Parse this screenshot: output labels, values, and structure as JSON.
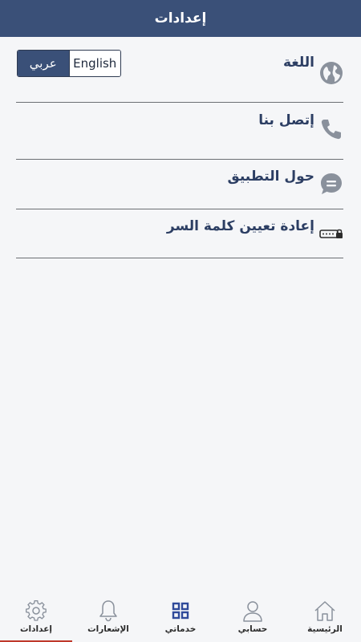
{
  "header": {
    "title": "إعدادات"
  },
  "settings": {
    "language": {
      "label": "اللغة",
      "options": {
        "arabic": "عربي",
        "english": "English"
      },
      "selected": "عربي"
    },
    "contact": {
      "label": "إتصل بنا"
    },
    "about": {
      "label": "حول التطبيق"
    },
    "reset_password": {
      "label": "إعادة تعيين كلمة السر"
    }
  },
  "bottom_nav": {
    "items": [
      {
        "label": "الرئيسية",
        "icon": "home-icon"
      },
      {
        "label": "حسابي",
        "icon": "user-icon"
      },
      {
        "label": "خدماتي",
        "icon": "grid-icon"
      },
      {
        "label": "الإشعارات",
        "icon": "bell-icon"
      },
      {
        "label": "إعدادات",
        "icon": "gear-icon"
      }
    ],
    "active": "إعدادات"
  },
  "colors": {
    "header_bg": "#3a5078",
    "label_text": "#2c3e63",
    "icon_gray": "#8a919c",
    "active_indicator": "#c0392b",
    "grid_icon_blue": "#2f4a9a"
  }
}
